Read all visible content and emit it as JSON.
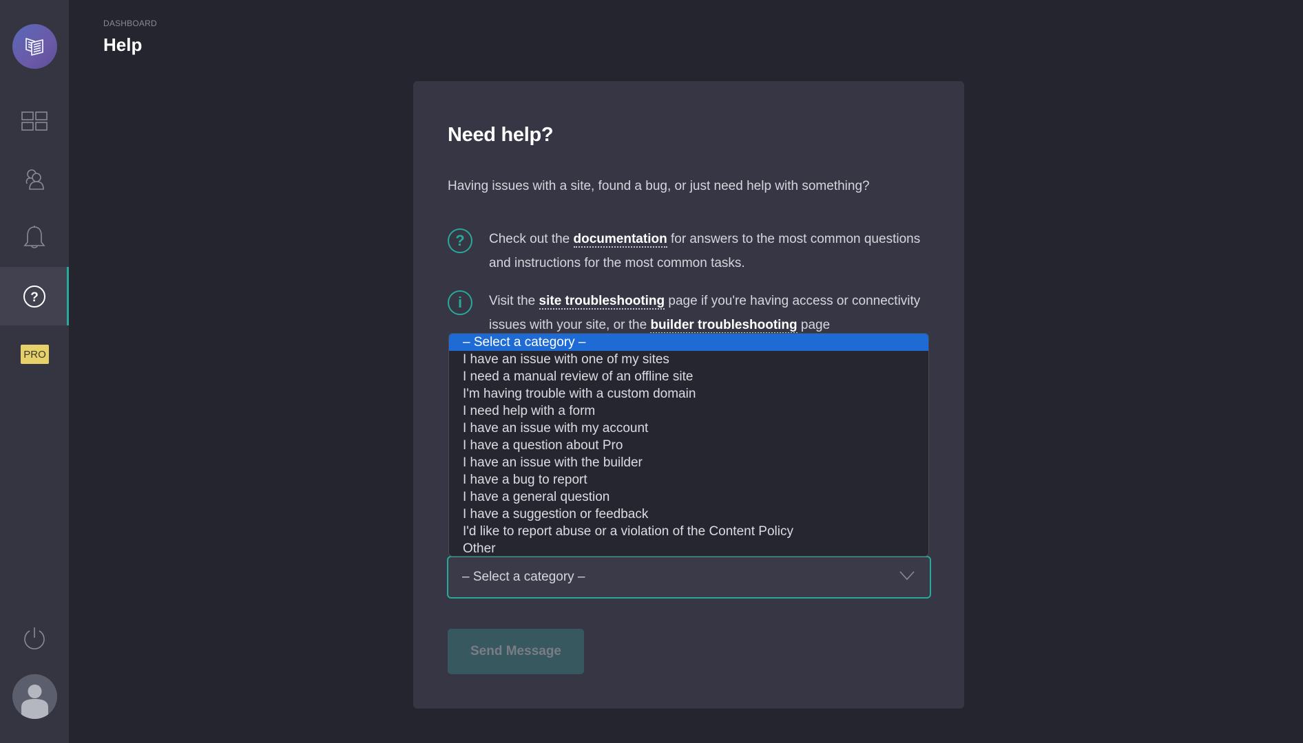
{
  "sidebar": {
    "logo_icon": "book-logo-icon",
    "nav": [
      {
        "name": "dashboard",
        "icon": "grid-icon",
        "active": false
      },
      {
        "name": "team",
        "icon": "users-icon",
        "active": false
      },
      {
        "name": "notifications",
        "icon": "bell-icon",
        "active": false
      },
      {
        "name": "help",
        "icon": "help-circle-icon",
        "active": true
      }
    ],
    "pro_badge": "PRO",
    "power_icon": "power-icon",
    "avatar_icon": "user-avatar-icon"
  },
  "header": {
    "breadcrumb": "DASHBOARD",
    "title": "Help"
  },
  "card": {
    "title": "Need help?",
    "intro": "Having issues with a site, found a bug, or just need help with something?",
    "tips": [
      {
        "icon": "question-circle-icon",
        "glyph": "?",
        "before": "Check out the ",
        "link": "documentation",
        "after": " for answers to the most common questions and instructions for the most common tasks."
      },
      {
        "icon": "info-circle-icon",
        "glyph": "i",
        "before": "Visit the ",
        "link": "site troubleshooting",
        "middle": " page if you're having access or connectivity issues with your site, or the ",
        "link2": "builder troubleshooting",
        "after": " page"
      }
    ],
    "category_select": {
      "value": "– Select a category –",
      "options": [
        "– Select a category –",
        "I have an issue with one of my sites",
        "I need a manual review of an offline site",
        "I'm having trouble with a custom domain",
        "I need help with a form",
        "I have an issue with my account",
        "I have a question about Pro",
        "I have an issue with the builder",
        "I have a bug to report",
        "I have a general question",
        "I have a suggestion or feedback",
        "I'd like to report abuse or a violation of the Content Policy",
        "Other"
      ],
      "highlighted_index": 0
    },
    "send_button": "Send Message"
  },
  "colors": {
    "accent": "#2aa89a",
    "highlight": "#1f6bd6",
    "pro": "#e6d16a"
  }
}
